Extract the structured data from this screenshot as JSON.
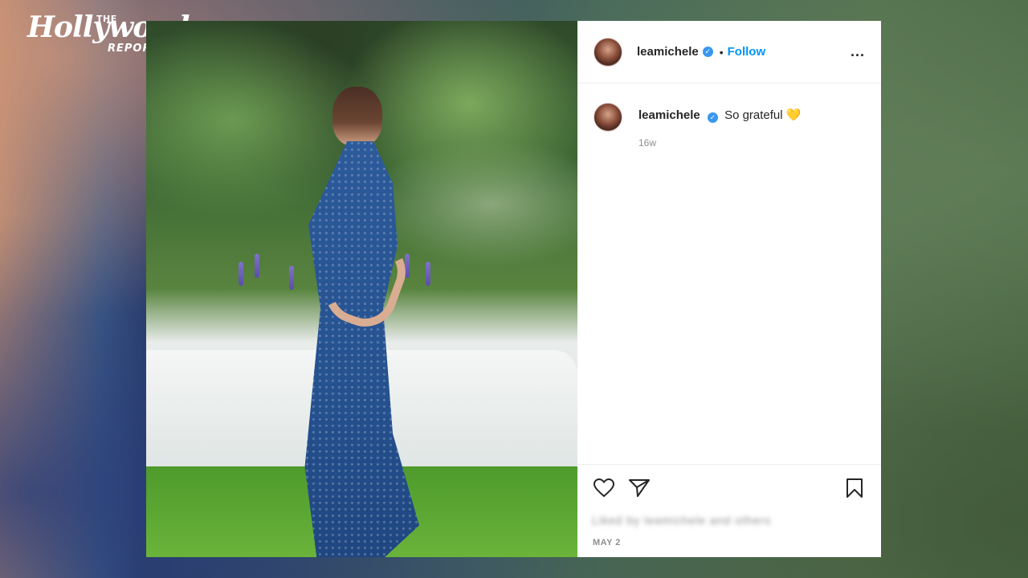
{
  "branding": {
    "the": "THE",
    "name": "Hollywood",
    "sub": "REPORTER"
  },
  "post": {
    "username": "leamichele",
    "follow_label": "Follow",
    "dot": "•",
    "more_label": "...",
    "caption": {
      "username": "leamichele",
      "text": "So grateful",
      "emoji": "💛",
      "time": "16w"
    },
    "likes_text": "Liked by leamichele and others",
    "date": "MAY 2"
  },
  "icons": [
    "verified-badge-icon",
    "heart-icon",
    "share-icon",
    "bookmark-icon",
    "more-options-icon"
  ],
  "colors": {
    "link_blue": "#0095f6",
    "verified_blue": "#3897f0",
    "text_primary": "#262626",
    "text_secondary": "#8e8e8e"
  }
}
